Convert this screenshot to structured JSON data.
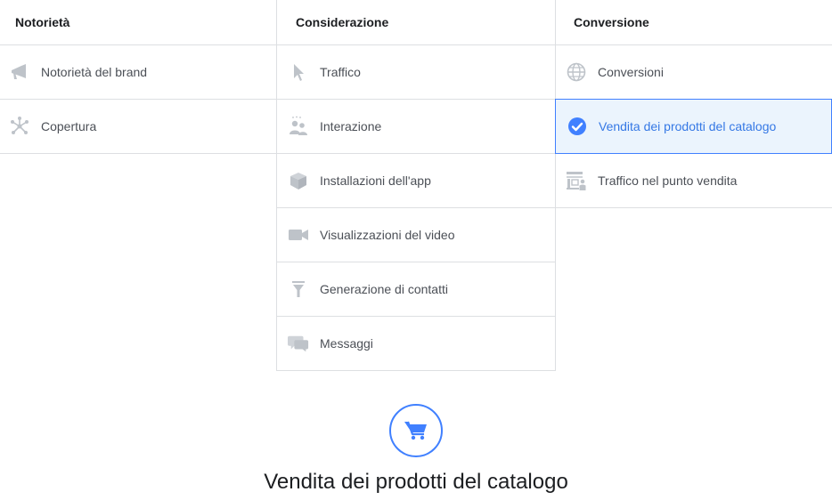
{
  "columns": [
    {
      "header": "Notorietà",
      "items": [
        {
          "label": "Notorietà del brand",
          "icon": "megaphone-icon"
        },
        {
          "label": "Copertura",
          "icon": "reach-icon"
        }
      ]
    },
    {
      "header": "Considerazione",
      "items": [
        {
          "label": "Traffico",
          "icon": "cursor-icon"
        },
        {
          "label": "Interazione",
          "icon": "people-icon"
        },
        {
          "label": "Installazioni dell'app",
          "icon": "box-icon"
        },
        {
          "label": "Visualizzazioni del video",
          "icon": "video-camera-icon"
        },
        {
          "label": "Generazione di contatti",
          "icon": "funnel-icon"
        },
        {
          "label": "Messaggi",
          "icon": "chat-bubbles-icon"
        }
      ]
    },
    {
      "header": "Conversione",
      "items": [
        {
          "label": "Conversioni",
          "icon": "globe-icon"
        },
        {
          "label": "Vendita dei prodotti del catalogo",
          "icon": "checkmark-circle-icon",
          "selected": true
        },
        {
          "label": "Traffico nel punto vendita",
          "icon": "store-icon"
        }
      ]
    }
  ],
  "selected_objective": {
    "title": "Vendita dei prodotti del catalogo",
    "icon": "shopping-cart-icon"
  },
  "colors": {
    "accent": "#4080ff",
    "selected_bg": "#ebf4fd",
    "icon_gray": "#bec3c9",
    "border": "#dddfe2"
  }
}
